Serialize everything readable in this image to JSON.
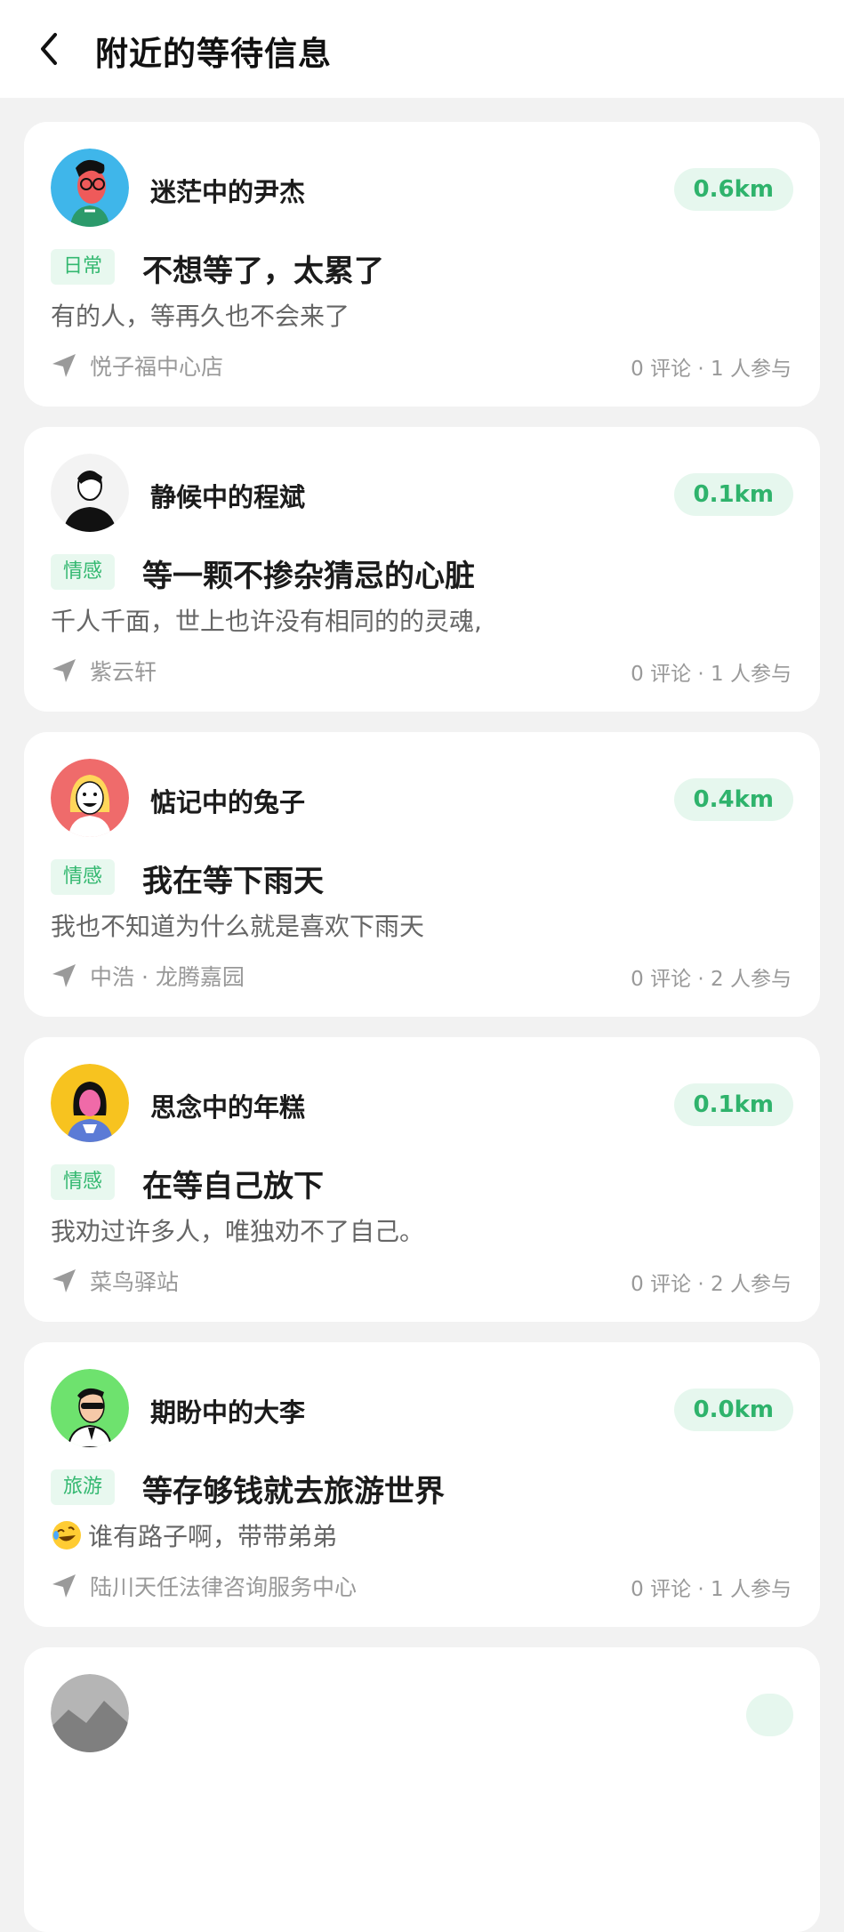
{
  "header": {
    "title": "附近的等待信息"
  },
  "colors": {
    "accent": "#2fb36c",
    "tag_bg": "#e8f8ef",
    "card_bg": "#ffffff",
    "page_bg": "#f2f2f2"
  },
  "cards": [
    {
      "avatar": "avatar-blue-man-icon",
      "username": "迷茫中的尹杰",
      "distance": "0.6km",
      "tag": "日常",
      "title": "不想等了，太累了",
      "desc": "有的人，等再久也不会来了",
      "location": "悦子福中心店",
      "stats": "0 评论 · 1 人参与"
    },
    {
      "avatar": "avatar-black-man-icon",
      "username": "静候中的程斌",
      "distance": "0.1km",
      "tag": "情感",
      "title": "等一颗不掺杂猜忌的心脏",
      "desc": "千人千面，世上也许没有相同的的灵魂,",
      "location": "紫云轩",
      "stats": "0 评论 · 1 人参与"
    },
    {
      "avatar": "avatar-blonde-woman-icon",
      "username": "惦记中的兔子",
      "distance": "0.4km",
      "tag": "情感",
      "title": "我在等下雨天",
      "desc": "我也不知道为什么就是喜欢下雨天",
      "location": "中浩 · 龙腾嘉园",
      "stats": "0 评论 · 2 人参与"
    },
    {
      "avatar": "avatar-pink-woman-icon",
      "username": "思念中的年糕",
      "distance": "0.1km",
      "tag": "情感",
      "title": "在等自己放下",
      "desc": "我劝过许多人，唯独劝不了自己。",
      "location": "菜鸟驿站",
      "stats": "0 评论 · 2 人参与"
    },
    {
      "avatar": "avatar-green-man-icon",
      "username": "期盼中的大李",
      "distance": "0.0km",
      "tag": "旅游",
      "title": "等存够钱就去旅游世界",
      "desc": "谁有路子啊，带带弟弟",
      "desc_emoji": "rolling-laughing-emoji",
      "location": "陆川天任法律咨询服务中心",
      "stats": "0 评论 · 1 人参与"
    }
  ]
}
